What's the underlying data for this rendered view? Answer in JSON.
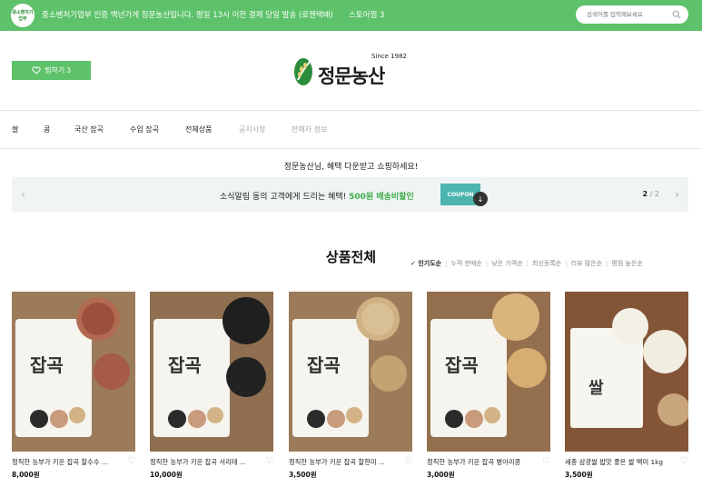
{
  "topbar": {
    "badge": "중소벤처기업부",
    "notice": "중소벤처기업부 인증 백년가게 정문농산입니다. 평일 13시 이전 결제 당일 발송 (로젠택배)",
    "store_link": "스토어찜 3",
    "search_placeholder": "검색어를 입력해보세요"
  },
  "header": {
    "like_button": "찜하기 3",
    "logo_since": "Since 1982",
    "logo_name": "정문농산"
  },
  "nav": {
    "items": [
      "쌀",
      "콩",
      "국산 잡곡",
      "수입 잡곡",
      "전체상품",
      "공지사항",
      "판매자 정보"
    ]
  },
  "greeting": "정문농산님, 혜택 다운받고 쇼핑하세요!",
  "coupon": {
    "message_prefix": "소식알림 동의 고객에게 드리는 혜택!",
    "message_highlight": "500원 배송비할인",
    "button_label": "COUPON",
    "page_current": "2",
    "page_total": "/ 2"
  },
  "section": {
    "title": "상품전체",
    "sorts": [
      "인기도순",
      "누적 판매순",
      "낮은 가격순",
      "최신등록순",
      "리뷰 많은순",
      "평점 높은순"
    ]
  },
  "products": [
    {
      "name": "정직한 농부가 키운 잡곡 찰수수 ...",
      "price": "8,000원"
    },
    {
      "name": "정직한 농부가 키운 잡곡 서리태 ...",
      "price": "10,000원"
    },
    {
      "name": "정직한 농부가 키운 잡곡 찰현미 ...",
      "price": "3,500원"
    },
    {
      "name": "정직한 농부가 키운 잡곡 병아리콩",
      "price": "3,000원"
    },
    {
      "name": "세종 삼광쌀 밥맛 좋은 쌀 백미 1kg",
      "price": "3,500원"
    }
  ],
  "colors": {
    "brand_green": "#5dc26a",
    "highlight_green": "#3fae4a",
    "coupon_teal": "#4db5b0"
  }
}
